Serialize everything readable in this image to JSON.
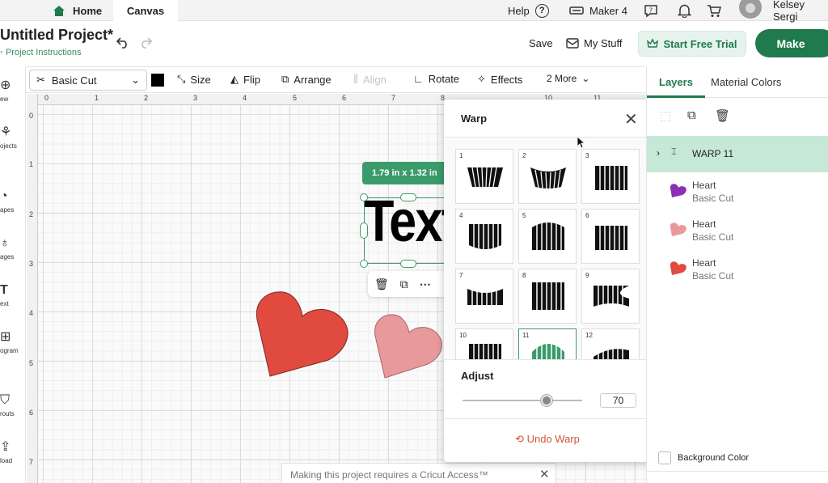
{
  "tabs": {
    "home": "Home",
    "canvas": "Canvas"
  },
  "topbar": {
    "help": "Help",
    "help_glyph": "?",
    "machine": "Maker 4",
    "user": "Kelsey Sergi"
  },
  "project": {
    "title": "Untitled Project*",
    "instructions": "Project Instructions"
  },
  "header": {
    "save": "Save",
    "my_stuff": "My Stuff",
    "trial": "Start Free Trial",
    "make": "Make"
  },
  "toolbar": {
    "operation": "Basic Cut",
    "swatch_color": "#000000",
    "size": "Size",
    "flip": "Flip",
    "arrange": "Arrange",
    "align": "Align",
    "rotate": "Rotate",
    "effects": "Effects",
    "more": "2 More"
  },
  "leftpanel": [
    "ew",
    "ojects",
    "apes",
    "ages",
    "ext",
    "ogram",
    "routs",
    "load"
  ],
  "ruler": {
    "top": [
      "0",
      "1",
      "2",
      "3",
      "4",
      "5",
      "6",
      "7",
      "8",
      "10",
      "11"
    ],
    "left": [
      "0",
      "1",
      "2",
      "3",
      "4",
      "5",
      "6",
      "7"
    ]
  },
  "canvas": {
    "dimensions": "1.79  in x 1.32  in",
    "text_object": "Text",
    "heart_red_color": "#e04a3f",
    "heart_pink_color": "#e8999b",
    "toast": "Making this project requires a Cricut Access™"
  },
  "warp": {
    "title": "Warp",
    "tiles": [
      "1",
      "2",
      "3",
      "4",
      "5",
      "6",
      "7",
      "8",
      "9",
      "10",
      "11",
      "12"
    ],
    "selected": "11",
    "adjust_label": "Adjust",
    "adjust_value": "70",
    "adjust_level": 0.7,
    "undo": "Undo Warp"
  },
  "layers": {
    "tab_layers": "Layers",
    "tab_material": "Material Colors",
    "group": "WARP 11",
    "items": [
      {
        "name": "Heart",
        "op": "Basic Cut",
        "color": "#8b2fb4"
      },
      {
        "name": "Heart",
        "op": "Basic Cut",
        "color": "#e8999b"
      },
      {
        "name": "Heart",
        "op": "Basic Cut",
        "color": "#e04a3f"
      }
    ],
    "background_color": "Background Color"
  },
  "accent_color": "#1f7a4d"
}
